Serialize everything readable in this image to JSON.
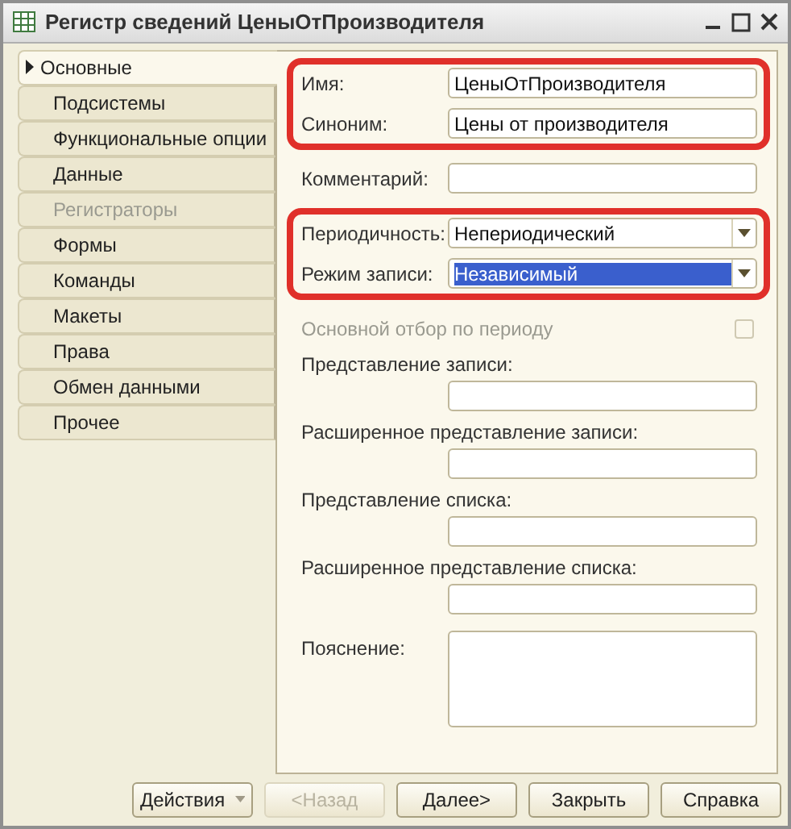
{
  "window": {
    "title": "Регистр сведений ЦеныОтПроизводителя"
  },
  "tabs": [
    {
      "label": "Основные",
      "selected": true,
      "disabled": false
    },
    {
      "label": "Подсистемы",
      "selected": false,
      "disabled": false
    },
    {
      "label": "Функциональные опции",
      "selected": false,
      "disabled": false
    },
    {
      "label": "Данные",
      "selected": false,
      "disabled": false
    },
    {
      "label": "Регистраторы",
      "selected": false,
      "disabled": true
    },
    {
      "label": "Формы",
      "selected": false,
      "disabled": false
    },
    {
      "label": "Команды",
      "selected": false,
      "disabled": false
    },
    {
      "label": "Макеты",
      "selected": false,
      "disabled": false
    },
    {
      "label": "Права",
      "selected": false,
      "disabled": false
    },
    {
      "label": "Обмен данными",
      "selected": false,
      "disabled": false
    },
    {
      "label": "Прочее",
      "selected": false,
      "disabled": false
    }
  ],
  "groups": [
    {
      "highlighted": true,
      "rows": [
        {
          "kind": "text",
          "label": "Имя:",
          "value": "ЦеныОтПроизводителя"
        },
        {
          "kind": "text",
          "label": "Синоним:",
          "value": "Цены от производителя"
        }
      ]
    },
    {
      "highlighted": false,
      "rows": [
        {
          "kind": "text",
          "label": "Комментарий:"
        }
      ]
    },
    {
      "highlighted": true,
      "rows": [
        {
          "kind": "select",
          "label": "Периодичность:",
          "value": "Непериодический",
          "selected": false
        },
        {
          "kind": "select",
          "label": "Режим записи:",
          "value": "Независимый",
          "selected": true
        }
      ]
    },
    {
      "highlighted": false,
      "rows": [
        {
          "kind": "checkbox",
          "label": "Основной отбор по периоду",
          "checked": false,
          "disabled": true
        },
        {
          "kind": "stacked",
          "label": "Представление записи:"
        },
        {
          "kind": "stacked",
          "label": "Расширенное представление записи:"
        },
        {
          "kind": "stacked",
          "label": "Представление списка:"
        },
        {
          "kind": "stacked",
          "label": "Расширенное представление списка:"
        },
        {
          "kind": "textarea",
          "label": "Пояснение:"
        }
      ]
    }
  ],
  "buttons": [
    {
      "label": "Действия",
      "kind": "menu",
      "disabled": false
    },
    {
      "label": "<Назад",
      "kind": "plain",
      "disabled": true
    },
    {
      "label": "Далее>",
      "kind": "plain",
      "disabled": false
    },
    {
      "label": "Закрыть",
      "kind": "plain",
      "disabled": false
    },
    {
      "label": "Справка",
      "kind": "plain",
      "disabled": false
    }
  ]
}
